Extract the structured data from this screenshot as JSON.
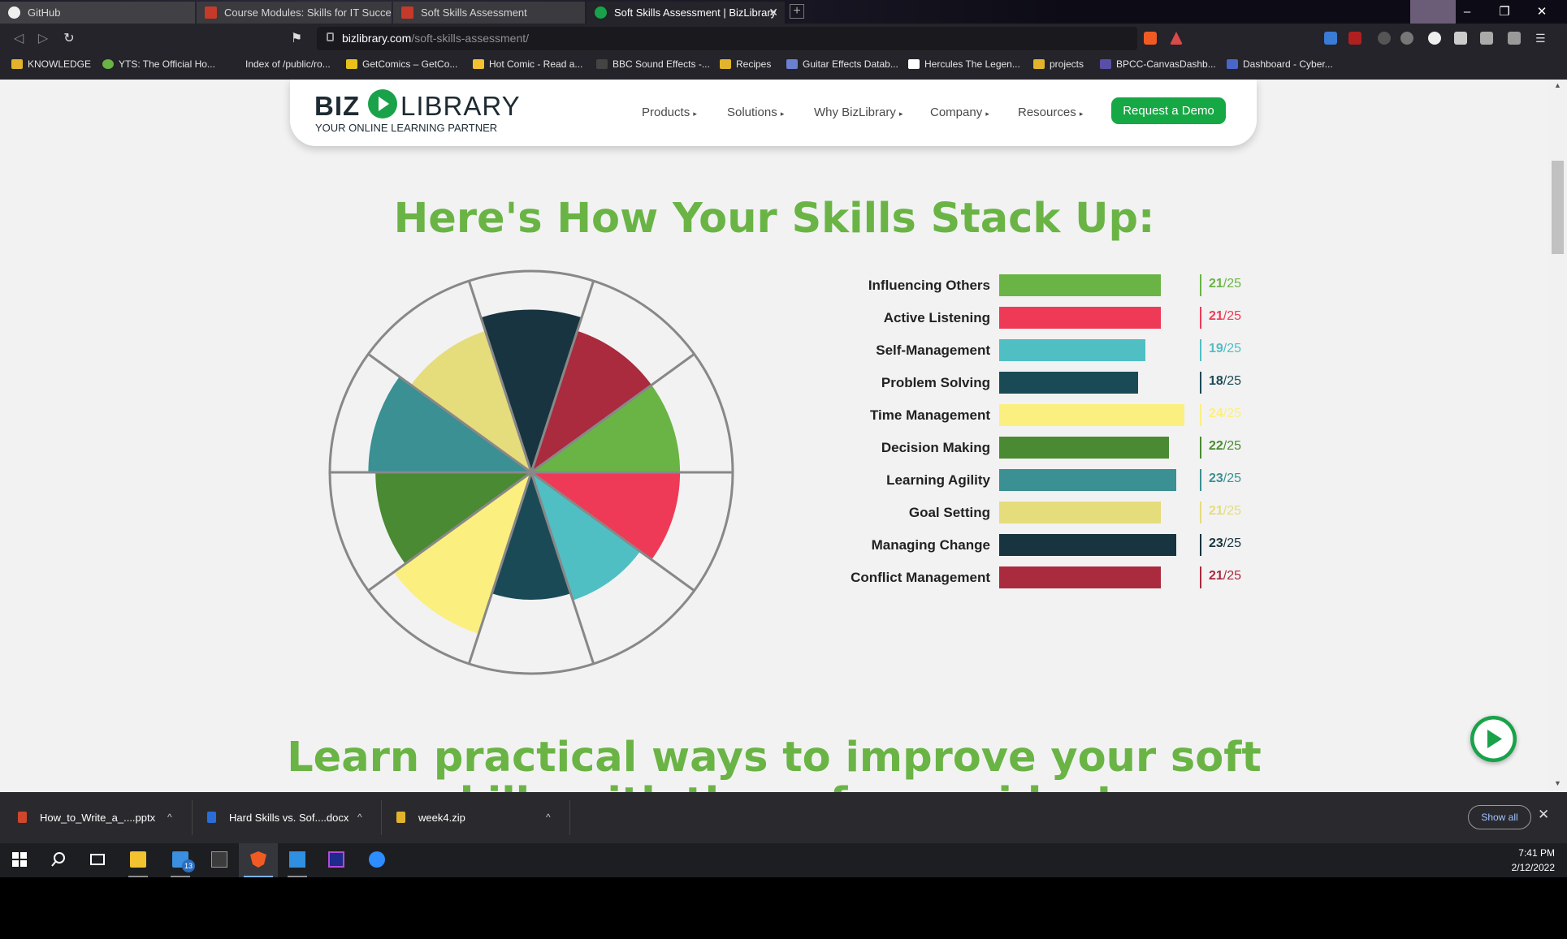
{
  "browser": {
    "tabs": [
      {
        "title": "GitHub"
      },
      {
        "title": "Course Modules: Skills for IT Success"
      },
      {
        "title": "Soft Skills Assessment"
      },
      {
        "title": "Soft Skills Assessment | BizLibrary"
      }
    ],
    "url_host": "bizlibrary.com",
    "url_path": "/soft-skills-assessment/",
    "extension_badge": "13",
    "bookmarks": [
      "KNOWLEDGE",
      "YTS: The Official Ho...",
      "Index of /public/ro...",
      "GetComics – GetCo...",
      "Hot Comic - Read a...",
      "BBC Sound Effects -...",
      "Recipes",
      "Guitar Effects Datab...",
      "Hercules The Legen...",
      "projects",
      "BPCC-CanvasDashb...",
      "Dashboard - Cyber..."
    ]
  },
  "site": {
    "logo_biz": "BIZ",
    "logo_library": "LIBRARY",
    "logo_tagline": "YOUR ONLINE LEARNING PARTNER",
    "nav": [
      "Products",
      "Solutions",
      "Why BizLibrary",
      "Company",
      "Resources"
    ],
    "cta": "Request a Demo",
    "headline": "Here's How Your Skills Stack Up:",
    "headline2": "Learn practical ways to improve your soft",
    "headline2_cut": "skills with these free guides!"
  },
  "chart_data": {
    "type": "bar",
    "orientation": "horizontal",
    "max": 25,
    "categories": [
      "Influencing Others",
      "Active Listening",
      "Self-Management",
      "Problem Solving",
      "Time Management",
      "Decision Making",
      "Learning Agility",
      "Goal Setting",
      "Managing Change",
      "Conflict Management"
    ],
    "values": [
      21,
      21,
      19,
      18,
      24,
      22,
      23,
      21,
      23,
      21
    ],
    "total_label": "/25",
    "colors": [
      "#6ab445",
      "#ee3a56",
      "#4fbfc4",
      "#1b4a57",
      "#fbf07f",
      "#4a8a32",
      "#3a9093",
      "#e5dc7c",
      "#173440",
      "#aa2a3e"
    ],
    "radial": {
      "type": "radial-sectors",
      "order": [
        "Managing Change",
        "Conflict Management",
        "Influencing Others",
        "Active Listening",
        "Self-Management",
        "Problem Solving",
        "Time Management",
        "Decision Making",
        "Learning Agility",
        "Goal Setting"
      ]
    }
  },
  "downloads": [
    {
      "name": "How_to_Write_a_....pptx",
      "color": "#d0462c"
    },
    {
      "name": "Hard Skills vs. Sof....docx",
      "color": "#2b6dd6"
    },
    {
      "name": "week4.zip",
      "color": "#e2b42b"
    }
  ],
  "downloads_show_all": "Show all",
  "taskbar": {
    "mail_badge": "13",
    "time": "7:41 PM",
    "date": "2/12/2022"
  }
}
